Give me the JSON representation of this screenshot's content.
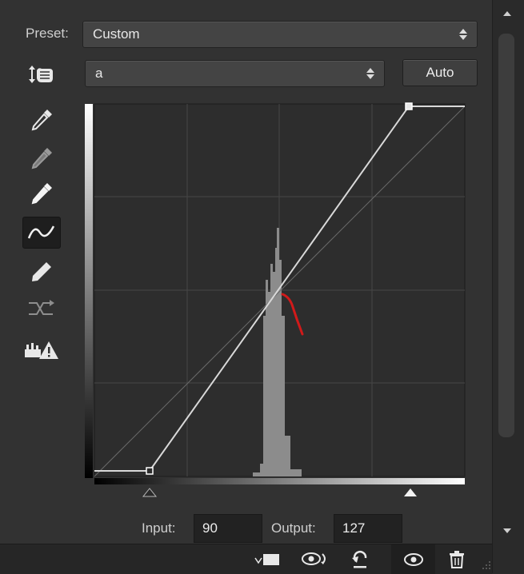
{
  "preset": {
    "label": "Preset:",
    "value": "Custom"
  },
  "channel": {
    "value": "a"
  },
  "auto_label": "Auto",
  "readout": {
    "input_label": "Input:",
    "input_value": "90",
    "output_label": "Output:",
    "output_value": "127"
  },
  "colors": {
    "panel_bg": "#323232",
    "graph_bg": "#2d2d2d",
    "annotation": "#d11a1a"
  }
}
